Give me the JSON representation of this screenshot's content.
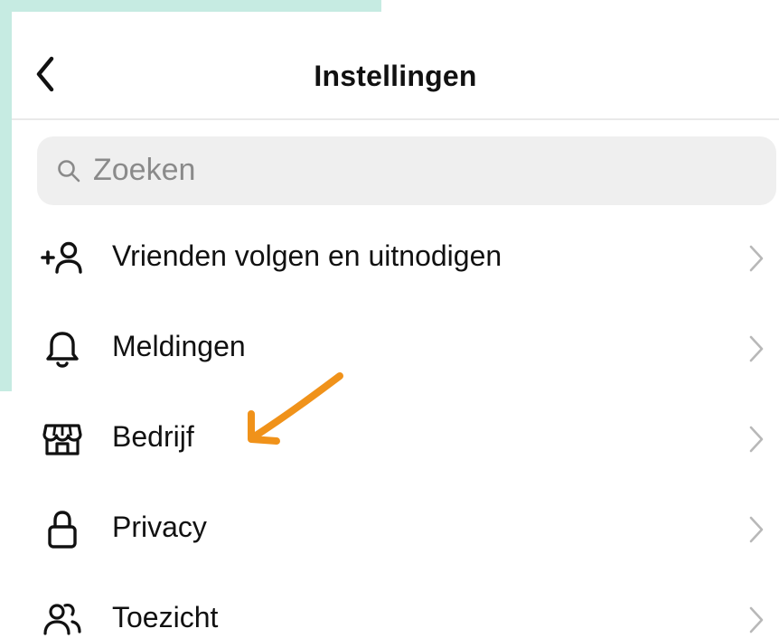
{
  "header": {
    "title": "Instellingen"
  },
  "search": {
    "placeholder": "Zoeken"
  },
  "menu": {
    "items": [
      {
        "label": "Vrienden volgen en uitnodigen",
        "icon": "add-person-icon"
      },
      {
        "label": "Meldingen",
        "icon": "bell-icon"
      },
      {
        "label": "Bedrijf",
        "icon": "shop-icon"
      },
      {
        "label": "Privacy",
        "icon": "lock-icon"
      },
      {
        "label": "Toezicht",
        "icon": "people-icon"
      }
    ]
  },
  "annotation": {
    "arrow_icon": "orange-arrow-icon",
    "arrow_color": "#f0921a"
  },
  "colors": {
    "background_accent": "#c6ebe2",
    "text": "#111111",
    "muted": "#8a8a8a",
    "chevron": "#b8b8b8"
  }
}
